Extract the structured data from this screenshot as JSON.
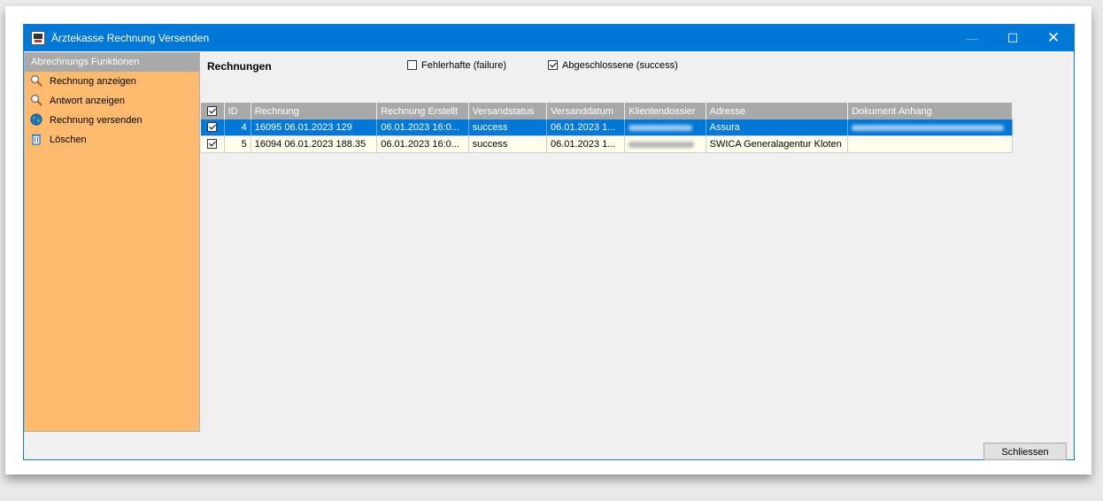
{
  "window": {
    "title": "Ärztekasse Rechnung Versenden"
  },
  "sidebar": {
    "header": "Abrechnungs Funktionen",
    "items": [
      {
        "label": "Rechnung anzeigen",
        "icon": "magnifier-icon"
      },
      {
        "label": "Antwort anzeigen",
        "icon": "magnifier-icon"
      },
      {
        "label": "Rechnung versenden",
        "icon": "globe-icon"
      },
      {
        "label": "Löschen",
        "icon": "trash-icon"
      }
    ]
  },
  "main": {
    "title": "Rechnungen",
    "filters": {
      "failure_label": "Fehlerhafte (failure)",
      "failure_checked": false,
      "success_label": "Abgeschlossene (success)",
      "success_checked": true
    },
    "table": {
      "columns": [
        "ID",
        "Rechnung",
        "Rechnung Erstellt",
        "Versandstatus",
        "Versanddatum",
        "Klientendossier",
        "Adresse",
        "Dokument Anhang"
      ],
      "rows": [
        {
          "checked": true,
          "selected": true,
          "id": "4",
          "rechnung": "16095 06.01.2023 129",
          "erstellt": "06.01.2023 16:0...",
          "status": "success",
          "datum": "06.01.2023 1...",
          "dossier": "",
          "adresse": "Assura",
          "anhang": ""
        },
        {
          "checked": true,
          "selected": false,
          "id": "5",
          "rechnung": "16094 06.01.2023 188.35",
          "erstellt": "06.01.2023 16:0...",
          "status": "success",
          "datum": "06.01.2023 1...",
          "dossier": "",
          "adresse": "SWICA Generalagentur Kloten",
          "anhang": ""
        }
      ]
    }
  },
  "footer": {
    "close_label": "Schliessen"
  }
}
